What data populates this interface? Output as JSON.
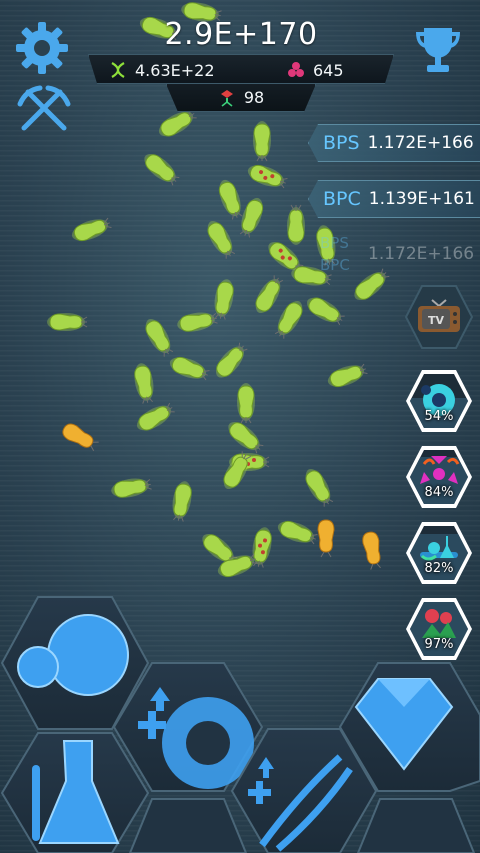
{
  "hud": {
    "bacteria_total": "2.9E+170",
    "dna": "4.63E+22",
    "mutagen": "645",
    "viruses": "98"
  },
  "stats": {
    "bps_label": "BPS",
    "bps_value": "1.172E+166",
    "bpc_label": "BPC",
    "bpc_value": "1.139E+161",
    "faded_bps_label": "BPS",
    "faded_bpc_label": "BPC",
    "faded_value": "1.172E+166"
  },
  "side_buttons": {
    "tv_label": "TV"
  },
  "boosts": [
    {
      "name": "virus-boost",
      "percent": "54%",
      "fill": 0.54
    },
    {
      "name": "radiation-boost",
      "percent": "84%",
      "fill": 0.84
    },
    {
      "name": "lab-boost",
      "percent": "82%",
      "fill": 0.82
    },
    {
      "name": "flower-boost",
      "percent": "97%",
      "fill": 0.97
    }
  ],
  "colors": {
    "accent_blue": "#4ab2ff",
    "bacteria_green": "#a8d84a",
    "bacteria_orange": "#f0b030",
    "stat_label": "#66c6ff"
  },
  "icons": {
    "settings": "gear-icon",
    "achievements": "trophy-icon",
    "mining": "crossed-pickaxes-icon",
    "dna": "dna-icon",
    "mutagen": "mutagen-icon",
    "virus": "virus-icon",
    "tv": "tv-icon",
    "evolve": "cell-icon",
    "research": "flask-icon",
    "upgrade": "gear-upgrade-icon",
    "dna_upgrade": "dna-upgrade-icon",
    "shop": "diamond-icon"
  }
}
